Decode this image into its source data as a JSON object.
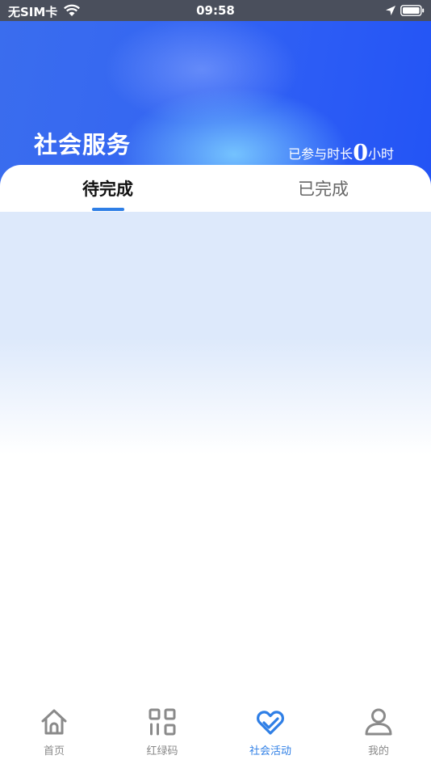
{
  "status_bar": {
    "carrier": "无SIM卡",
    "time": "09:58"
  },
  "header": {
    "title": "社会服务",
    "duration_prefix": "已参与时长",
    "duration_value": "0",
    "duration_unit": "小时"
  },
  "tabs": [
    {
      "label": "待完成",
      "active": true
    },
    {
      "label": "已完成",
      "active": false
    }
  ],
  "tabbar": {
    "items": [
      {
        "label": "首页",
        "icon": "home-icon"
      },
      {
        "label": "红绿码",
        "icon": "grid-code-icon"
      },
      {
        "label": "社会活动",
        "icon": "heart-check-icon",
        "active": true
      },
      {
        "label": "我的",
        "icon": "person-icon"
      }
    ]
  },
  "colors": {
    "accent": "#2f7fe6",
    "header_blue": "#2c5cf5",
    "inactive": "#8a8a8a"
  }
}
